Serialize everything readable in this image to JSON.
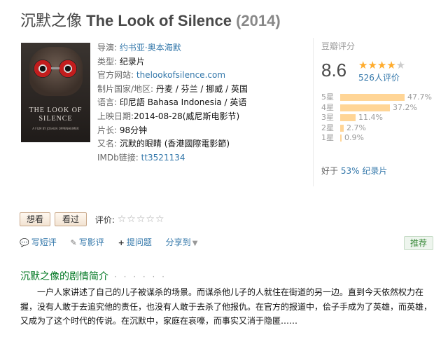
{
  "movie": {
    "title_zh": "沉默之像",
    "title_en": "The Look of Silence",
    "year": "(2014)"
  },
  "poster": {
    "line1": "THE LOOK OF",
    "line2": "SILENCE",
    "credit": "A FILM BY JOSHUA OPPENHEIMER"
  },
  "info": {
    "director_label": "导演:",
    "director": "约书亚·奥本海默",
    "genre_label": "类型:",
    "genre": "纪录片",
    "website_label": "官方网站:",
    "website": "thelookofsilence.com",
    "country_label": "制片国家/地区:",
    "country": "丹麦 / 芬兰 / 挪威 / 英国",
    "language_label": "语言:",
    "language": "印尼語 Bahasa Indonesia / 英语",
    "release_label": "上映日期:",
    "release": "2014-08-28(威尼斯电影节)",
    "runtime_label": "片长:",
    "runtime": "98分钟",
    "aka_label": "又名:",
    "aka": "沉默的眼睛 (香港國際電影節)",
    "imdb_label": "IMDb链接:",
    "imdb": "tt3521134"
  },
  "rating": {
    "title": "豆瓣评分",
    "score": "8.6",
    "stars": 4.5,
    "count": "526人评价",
    "distribution": [
      {
        "label": "5星",
        "percent": "47.7%",
        "value": 47.7
      },
      {
        "label": "4星",
        "percent": "37.2%",
        "value": 37.2
      },
      {
        "label": "3星",
        "percent": "11.4%",
        "value": 11.4
      },
      {
        "label": "2星",
        "percent": "2.7%",
        "value": 2.7
      },
      {
        "label": "1星",
        "percent": "0.9%",
        "value": 0.9
      }
    ],
    "better_prefix": "好于",
    "better_link": "53% 纪录片"
  },
  "user": {
    "want_label": "想看",
    "seen_label": "看过",
    "rate_label": "评价:"
  },
  "actions": {
    "short_review": "写短评",
    "review": "写影评",
    "question": "提问题",
    "share": "分享到",
    "recommend": "推荐"
  },
  "synopsis": {
    "title": "沉默之像的剧情简介",
    "dots": "· · · · · ·",
    "text": "一户人家讲述了自己的儿子被谋杀的场景。而谋杀他儿子的人就住在街道的另一边。直到今天依然权力在握，没有人敢于去追究他的责任，也没有人敢于去杀了他报仇。在官方的报道中，侩子手成为了英雄，而英雄，又成为了这个时代的传说。在沉默中，家庭在哀嚎，而事实又消于隐匿……"
  },
  "colors": {
    "link": "#3377aa",
    "star": "#ffac2d",
    "bar": "#ffd596",
    "synopsis_title": "#007722"
  }
}
